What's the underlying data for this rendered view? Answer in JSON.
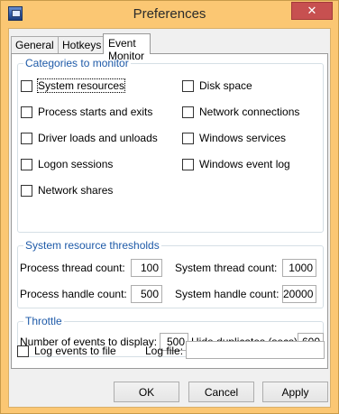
{
  "window": {
    "title": "Preferences",
    "close_glyph": "✕"
  },
  "tabs": [
    {
      "label": "General"
    },
    {
      "label": "Hotkeys"
    },
    {
      "label": "Event Monitor"
    }
  ],
  "categories": {
    "legend": "Categories to monitor",
    "items": [
      {
        "label": "System resources",
        "checked": false
      },
      {
        "label": "Disk space",
        "checked": false
      },
      {
        "label": "Process starts and exits",
        "checked": false
      },
      {
        "label": "Network connections",
        "checked": false
      },
      {
        "label": "Driver loads and unloads",
        "checked": false
      },
      {
        "label": "Windows services",
        "checked": false
      },
      {
        "label": "Logon sessions",
        "checked": false
      },
      {
        "label": "Windows event log",
        "checked": false
      },
      {
        "label": "Network shares",
        "checked": false
      }
    ]
  },
  "thresholds": {
    "legend": "System resource thresholds",
    "process_thread_label": "Process thread count:",
    "process_thread_value": "100",
    "system_thread_label": "System thread count:",
    "system_thread_value": "1000",
    "process_handle_label": "Process handle count:",
    "process_handle_value": "500",
    "system_handle_label": "System handle count:",
    "system_handle_value": "20000"
  },
  "throttle": {
    "legend": "Throttle",
    "events_label": "Number of events to display:",
    "events_value": "500",
    "hide_dup_label": "Hide duplicates (secs):",
    "hide_dup_value": "600"
  },
  "logging": {
    "log_events_label": "Log events to file",
    "log_events_checked": false,
    "log_file_label": "Log file:",
    "log_file_value": ""
  },
  "buttons": {
    "ok": "OK",
    "cancel": "Cancel",
    "apply": "Apply"
  }
}
